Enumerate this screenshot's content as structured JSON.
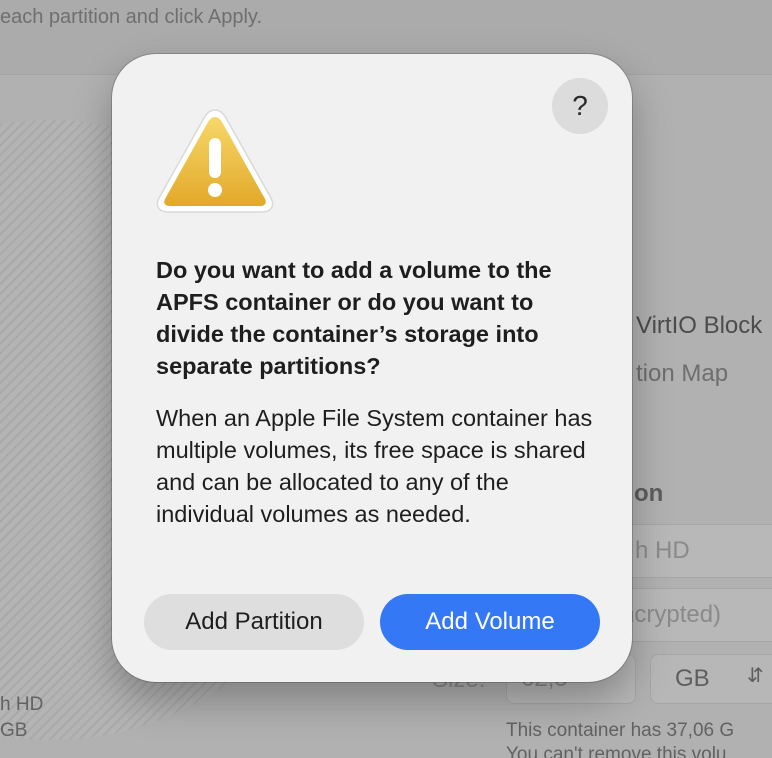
{
  "background": {
    "instruction": "each partition and click Apply.",
    "disk_name_partial": "h HD",
    "disk_size_partial": "GB",
    "info_device_partial": "VirtIO Block",
    "info_scheme_partial": "tion Map",
    "section_heading_partial": "on",
    "name_field_partial": "h HD",
    "format_field_partial": "ncrypted)",
    "size_label_partial": "Size:",
    "size_value_partial": "62,5",
    "size_unit": "GB",
    "container_note_line1": "This container has 37,06 G",
    "container_note_line2": "You can't remove this volu"
  },
  "dialog": {
    "help_label": "?",
    "title": "Do you want to add a volume to the APFS container or do you want to divide the container’s storage into separate partitions?",
    "body": "When an Apple File System container has multiple volumes, its free space is shared and can be allocated to any of the individual volumes as needed.",
    "secondary_button": "Add Partition",
    "primary_button": "Add Volume"
  },
  "colors": {
    "primary_accent": "#3478f6",
    "warning_yellow": "#f0c23a"
  }
}
